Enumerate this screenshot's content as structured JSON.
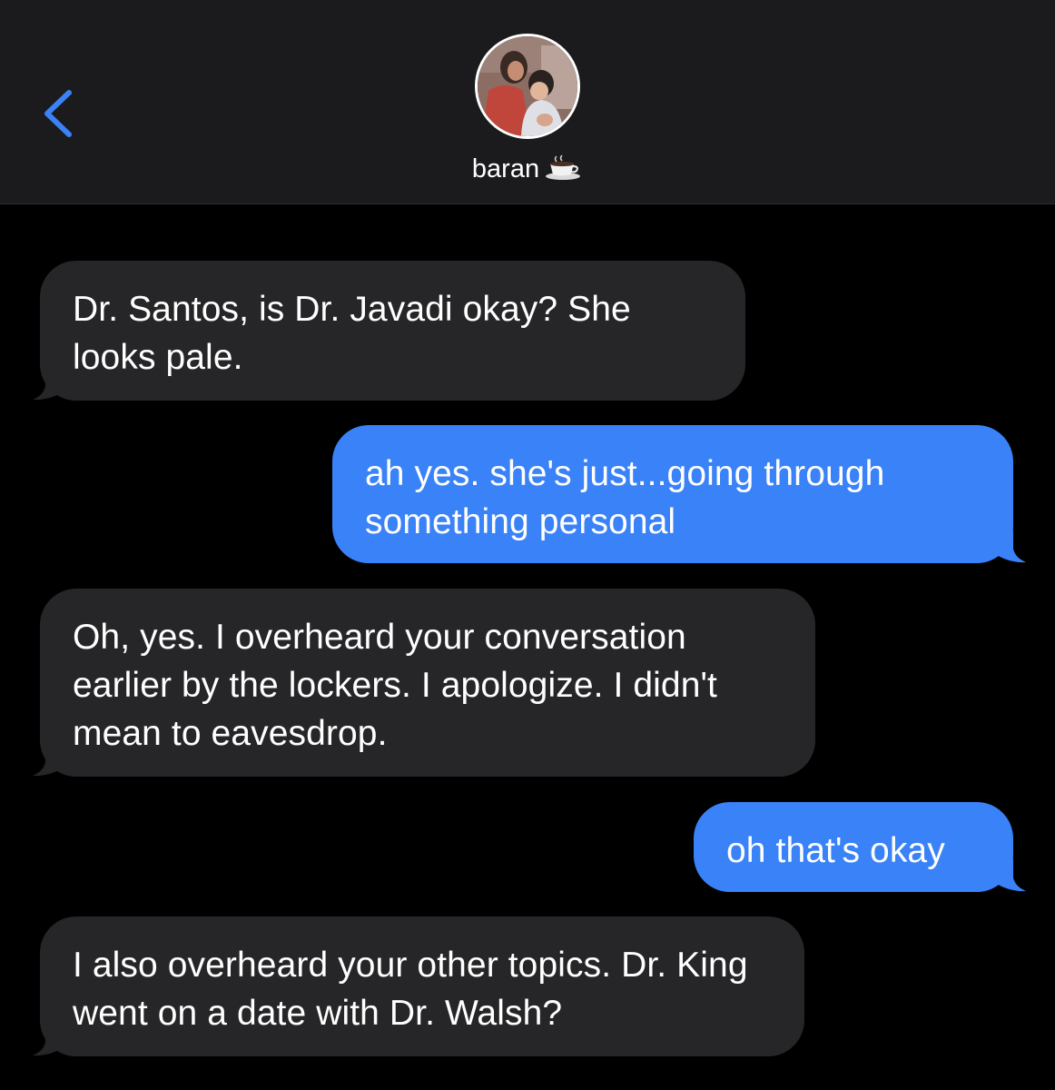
{
  "header": {
    "contact_name": "baran",
    "status_emoji_icon": "coffee-cup-icon",
    "back_icon": "chevron-left-icon"
  },
  "colors": {
    "header_bg": "#1b1b1d",
    "background": "#000000",
    "incoming_bubble": "#262628",
    "outgoing_bubble": "#3a82f7",
    "accent": "#3a82f7",
    "text": "#ffffff"
  },
  "messages": [
    {
      "direction": "incoming",
      "text": "Dr. Santos, is Dr. Javadi okay? She looks pale."
    },
    {
      "direction": "outgoing",
      "text": "ah yes. she's just...going through something personal"
    },
    {
      "direction": "incoming",
      "text": "Oh, yes. I overheard your conversation earlier by the lockers. I apologize. I didn't mean to eavesdrop."
    },
    {
      "direction": "outgoing",
      "text": "oh that's okay"
    },
    {
      "direction": "incoming",
      "text": "I also overheard your other topics. Dr. King went on a date with Dr. Walsh?"
    }
  ]
}
